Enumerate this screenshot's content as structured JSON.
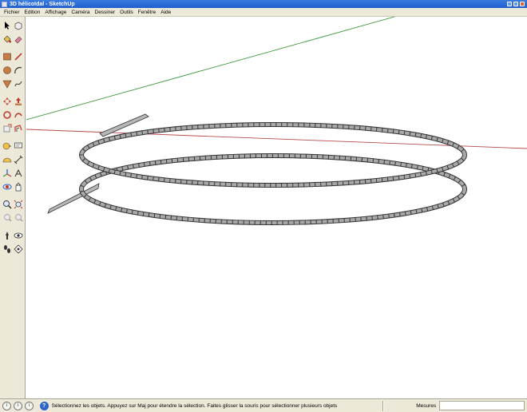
{
  "window": {
    "title": "3D hélicoïdal - SketchUp"
  },
  "menu": [
    "Fichier",
    "Edition",
    "Affichage",
    "Caméra",
    "Dessiner",
    "Outils",
    "Fenêtre",
    "Aide"
  ],
  "toolbar": {
    "tools": [
      [
        "select-arrow-icon",
        "component-icon"
      ],
      [
        "paint-bucket-icon",
        "eraser-icon"
      ],
      [
        "rectangle-icon",
        "line-icon"
      ],
      [
        "circle-icon",
        "arc-icon"
      ],
      [
        "polygon-icon",
        "freehand-icon"
      ],
      [
        "move-icon",
        "push-pull-icon"
      ],
      [
        "rotate-icon",
        "follow-me-icon"
      ],
      [
        "scale-icon",
        "offset-icon"
      ],
      [
        "tape-measure-icon",
        "text-icon"
      ],
      [
        "protractor-icon",
        "dimension-icon"
      ],
      [
        "axes-icon",
        "3d-text-icon"
      ],
      [
        "orbit-icon",
        "pan-icon"
      ],
      [
        "zoom-icon",
        "zoom-extents-icon"
      ],
      [
        "previous-view-icon",
        "next-view-icon"
      ],
      [
        "position-camera-icon",
        "look-around-icon"
      ],
      [
        "walk-icon",
        "section-plane-icon"
      ]
    ]
  },
  "status": {
    "message": "Sélectionnez les objets. Appuyez sur Maj pour étendre la sélection. Faites glisser la souris pour sélectionner plusieurs objets",
    "measure_label": "Mesures",
    "measure_value": ""
  },
  "colors": {
    "green_axis": "#3a9a3a",
    "red_axis": "#b84a4a",
    "helix_stroke": "#333333",
    "helix_fill": "#a9a9a9"
  }
}
